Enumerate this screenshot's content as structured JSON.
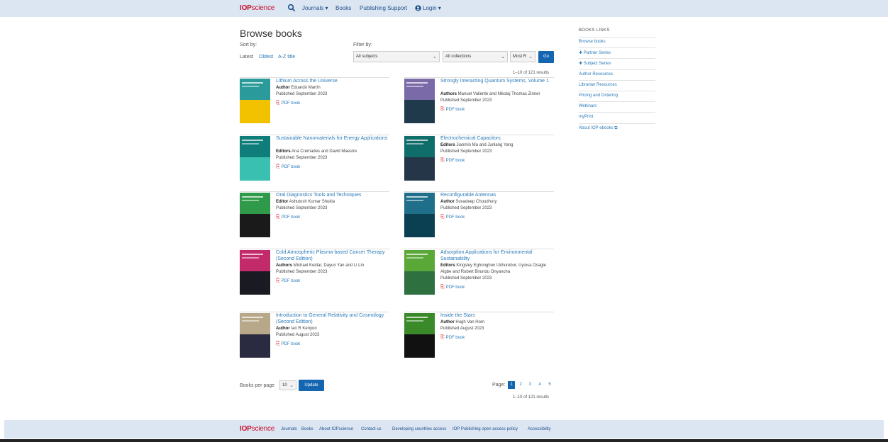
{
  "brand": {
    "bold": "IOP",
    "rest": "science"
  },
  "nav": {
    "journals": "Journals ▾",
    "books": "Books",
    "publishing_support": "Publishing Support",
    "login": "Login ▾"
  },
  "page": {
    "title": "Browse books",
    "sort_label": "Sort by:",
    "filter_label": "Filter by:"
  },
  "sort": {
    "latest": "Latest",
    "oldest": "Oldest",
    "az": "A-Z title"
  },
  "filters": {
    "subjects": "All subjects",
    "collections": "All collections",
    "order": "Most R",
    "go": "Go"
  },
  "results_text": "1–10 of 121 results",
  "pdf_label": "PDF book",
  "books": [
    {
      "title": "Lithium Across the Universe",
      "role": "Author",
      "people": "Eduardo Martín",
      "published": "Published September 2023",
      "cover": "#2a9a9a",
      "accent": "#f2c200"
    },
    {
      "title": "Strongly Interacting Quantum Systems, Volume 1",
      "role": "Authors",
      "people": "Manuel Valiente and Nikolaj Thomas Zinner",
      "published": "Published September 2023",
      "cover": "#7a6aa8",
      "accent": "#1f3a4a"
    },
    {
      "title": "Sustainable Nanomaterials for Energy Applications",
      "role": "Editors",
      "people": "Ana Cremades and David Maestre",
      "published": "Published September 2023",
      "cover": "#0f7d7a",
      "accent": "#3ac0b0"
    },
    {
      "title": "Electrochemical Capacitors",
      "role": "Editors",
      "people": "Jianmin Ma and Junlang Yang",
      "published": "Published September 2023",
      "cover": "#0f6d6a",
      "accent": "#243648"
    },
    {
      "title": "Oral Diagnostics Tools and Techniques",
      "role": "Editor",
      "people": "Ashutosh Kumar Shukla",
      "published": "Published September 2023",
      "cover": "#2f9b4a",
      "accent": "#1a1a1a"
    },
    {
      "title": "Reconfigurable Antennas",
      "role": "Author",
      "people": "Suvadeep Choudhury",
      "published": "Published September 2023",
      "cover": "#1f6e8a",
      "accent": "#0b3f52"
    },
    {
      "title": "Cold Atmospheric Plasma-based Cancer Therapy (Second Edition)",
      "role": "Authors",
      "people": "Michael Keidar, Dayun Yan and Li Lin",
      "published": "Published September 2023",
      "cover": "#c22a6a",
      "accent": "#1a1a22"
    },
    {
      "title": "Adsorption Applications for Environmental Sustainability",
      "role": "Editors",
      "people": "Kingsley Eghonghon Ukhurebor, Uyiosa Osagie Aigbe and Robert Birundu Onyancha",
      "published": "Published September 2023",
      "cover": "#5aa838",
      "accent": "#2e7040"
    },
    {
      "title": "Introduction to General Relativity and Cosmology (Second Edition)",
      "role": "Author",
      "people": "Ian R Kenyon",
      "published": "Published August 2023",
      "cover": "#b8a88a",
      "accent": "#2a2a40"
    },
    {
      "title": "Inside the Stars",
      "role": "Author",
      "people": "Hugh Van Horn",
      "published": "Published August 2023",
      "cover": "#3a8a2a",
      "accent": "#111"
    }
  ],
  "per_page": {
    "label": "Books per page",
    "value": "10",
    "update": "Update"
  },
  "pagination": {
    "label": "Page:",
    "pages": [
      "1",
      "2",
      "3",
      "4",
      "5"
    ],
    "current": "1"
  },
  "sidebar": {
    "heading": "BOOKS LINKS",
    "items": [
      "Browse books",
      "✚ Partner Series",
      "✚ Subject Series",
      "Author Resources",
      "Librarian Resources",
      "Pricing and Ordering",
      "Webinars",
      "myPrint",
      "About IOP ebooks ⧉"
    ]
  },
  "footer": {
    "links": [
      "Journals",
      "Books",
      "About IOPscience",
      "Contact us",
      "Developing countries access",
      "IOP Publishing open access policy",
      "Accessibility"
    ]
  }
}
